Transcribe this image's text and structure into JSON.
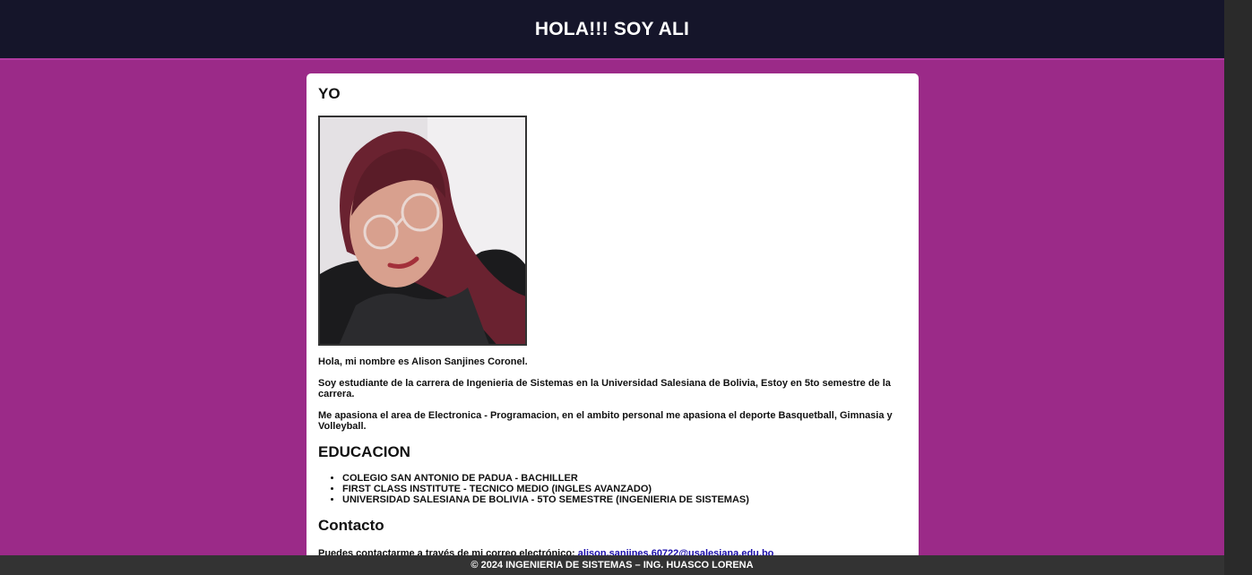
{
  "header": {
    "title": "HOLA!!! SOY ALI"
  },
  "about": {
    "heading": "YO",
    "photo_alt": "Foto de Alison",
    "intro": "Hola, mi nombre es Alison Sanjines Coronel.",
    "study": "Soy estudiante de la carrera de Ingenieria de Sistemas en la Universidad Salesiana de Bolivia, Estoy en 5to semestre de la carrera.",
    "passion": "Me apasiona el area de Electronica - Programacion, en el ambito personal me apasiona el deporte Basquetball, Gimnasia y Volleyball."
  },
  "education": {
    "heading": "EDUCACION",
    "items": [
      "COLEGIO SAN ANTONIO DE PADUA - BACHILLER",
      "FIRST CLASS INSTITUTE - TECNICO MEDIO (INGLES AVANZADO)",
      "UNIVERSIDAD SALESIANA DE BOLIVIA - 5TO SEMESTRE (INGENIERIA DE SISTEMAS)"
    ]
  },
  "contact": {
    "heading": "Contacto",
    "text": "Puedes contactarme a través de mi correo electrónico: ",
    "email": "alison.sanjines.60722@usalesiana.edu.bo"
  },
  "footer": {
    "text": "© 2024 INGENIERIA DE SISTEMAS – ING. HUASCO LORENA"
  },
  "colors": {
    "background": "#9b2a88",
    "header": "#15152a",
    "footer": "#333333",
    "link": "#1a0dab"
  }
}
